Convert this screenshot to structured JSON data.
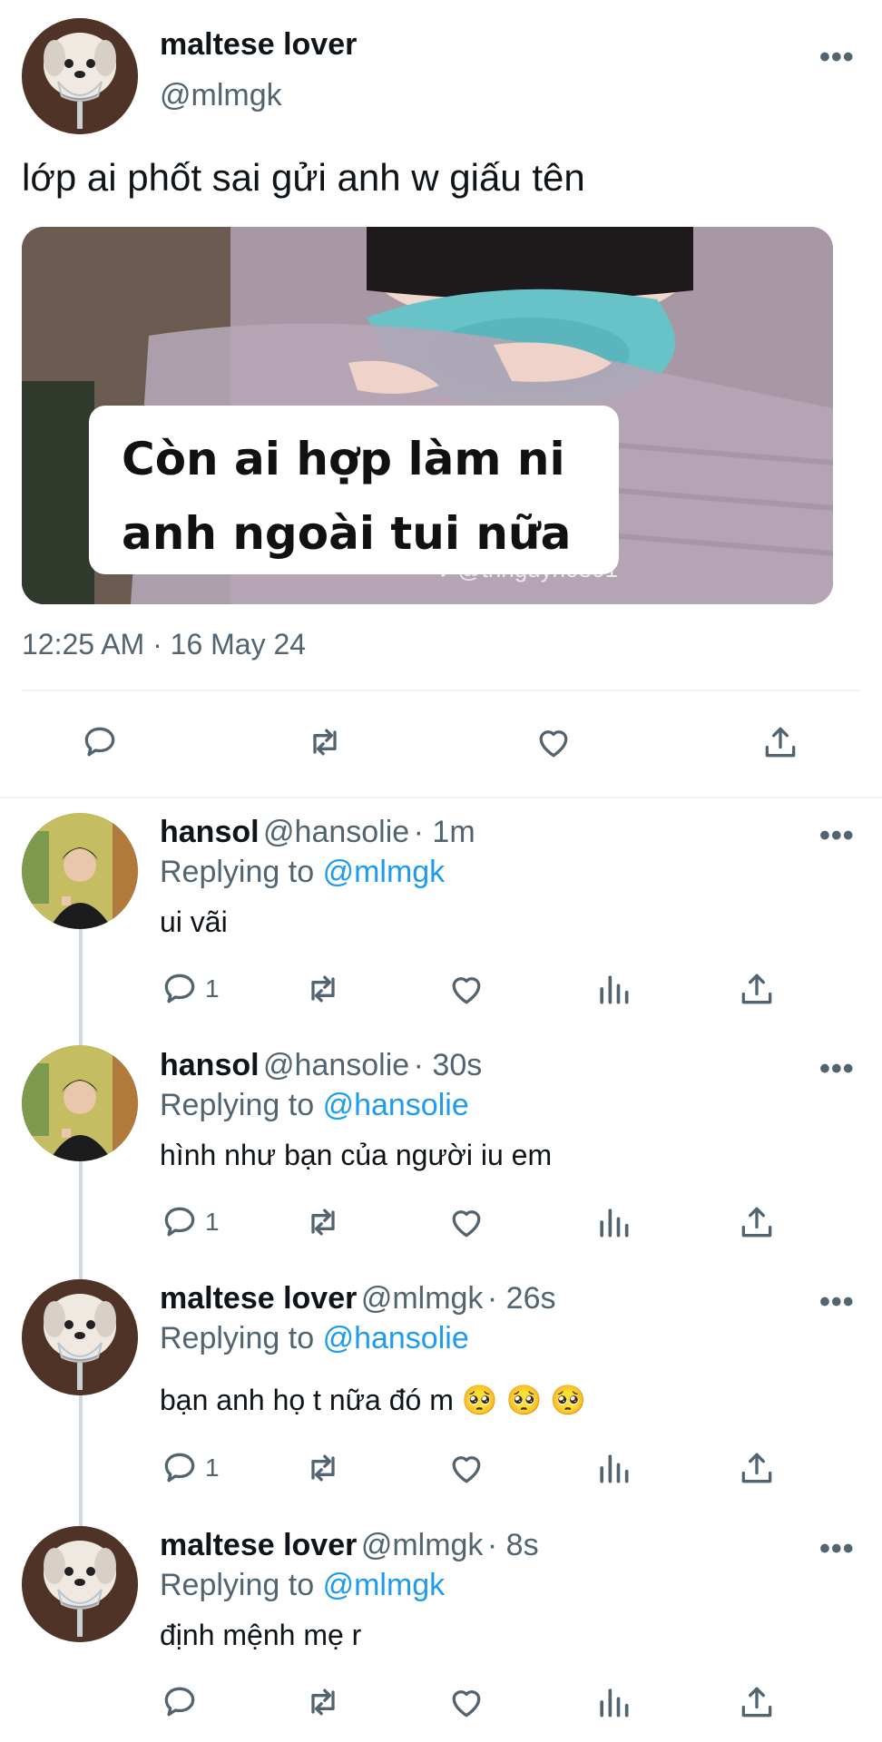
{
  "main_tweet": {
    "name": "maltese lover",
    "handle": "@mlmgk",
    "text": "lớp ai phốt sai gửi anh w giấu tên",
    "media": {
      "caption_line1": "Còn ai hợp làm ni",
      "caption_line2": "anh ngoài tui nữa",
      "watermark": "♪ @thnguyn0301"
    },
    "timestamp": "12:25 AM · 16 May 24",
    "more": "•••"
  },
  "replies": [
    {
      "name": "hansol",
      "handle": "@hansolie",
      "time": "· 1m",
      "replying_prefix": "Replying to",
      "replying_to": "@mlmgk",
      "text": "ui vãi",
      "reply_count": "1",
      "more": "•••"
    },
    {
      "name": "hansol",
      "handle": "@hansolie",
      "time": "· 30s",
      "replying_prefix": "Replying to",
      "replying_to": "@hansolie",
      "text": "hình như bạn của người iu em",
      "reply_count": "1",
      "more": "•••"
    },
    {
      "name": "maltese lover",
      "handle": "@mlmgk",
      "time": "· 26s",
      "replying_prefix": "Replying to",
      "replying_to": "@hansolie",
      "text": "bạn anh họ t nữa đó m 🥺 🥺 🥺",
      "reply_count": "1",
      "more": "•••"
    },
    {
      "name": "maltese lover",
      "handle": "@mlmgk",
      "time": "· 8s",
      "replying_prefix": "Replying to",
      "replying_to": "@mlmgk",
      "text": "định mệnh mẹ r",
      "reply_count": "",
      "more": "•••"
    }
  ],
  "icons": {
    "reply": "reply-icon",
    "retweet": "retweet-icon",
    "like": "like-icon",
    "views": "views-icon",
    "share": "share-icon"
  },
  "colors": {
    "link": "#1d9bf0",
    "muted": "#536471",
    "text": "#0f1419"
  }
}
